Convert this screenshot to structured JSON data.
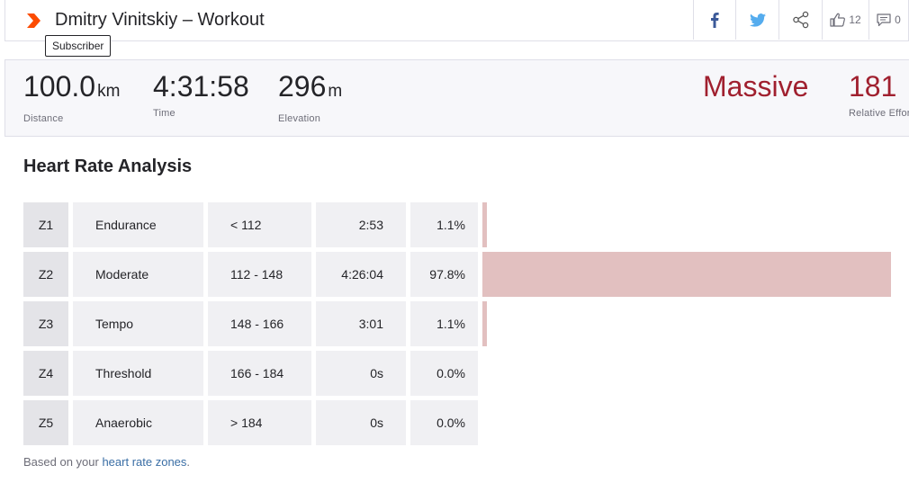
{
  "header": {
    "title": "Dmitry Vinitskiy – Workout",
    "tooltip": "Subscriber",
    "kudos_count": "12",
    "comment_count": "0"
  },
  "stats": [
    {
      "value": "100.0",
      "unit": "km",
      "label": "Distance"
    },
    {
      "value": "4:31:58",
      "unit": "",
      "label": "Time"
    },
    {
      "value": "296",
      "unit": "m",
      "label": "Elevation"
    }
  ],
  "relative_effort": {
    "level": "Massive",
    "value": "181",
    "label": "Relative Effort"
  },
  "heart_rate": {
    "title": "Heart Rate Analysis",
    "zones": [
      {
        "zone": "Z1",
        "name": "Endurance",
        "range": "< 112",
        "time": "2:53",
        "percent": "1.1%",
        "fraction": 0.011
      },
      {
        "zone": "Z2",
        "name": "Moderate",
        "range": "112 - 148",
        "time": "4:26:04",
        "percent": "97.8%",
        "fraction": 0.978
      },
      {
        "zone": "Z3",
        "name": "Tempo",
        "range": "148 - 166",
        "time": "3:01",
        "percent": "1.1%",
        "fraction": 0.011
      },
      {
        "zone": "Z4",
        "name": "Threshold",
        "range": "166 - 184",
        "time": "0s",
        "percent": "0.0%",
        "fraction": 0.0
      },
      {
        "zone": "Z5",
        "name": "Anaerobic",
        "range": "> 184",
        "time": "0s",
        "percent": "0.0%",
        "fraction": 0.0
      }
    ],
    "footnote_prefix": "Based on your ",
    "footnote_link": "heart rate zones",
    "footnote_suffix": "."
  },
  "colors": {
    "accent": "#fc4c02",
    "effort_red": "#a0202f",
    "bar_fill": "#e2c0c0",
    "facebook": "#3b5998",
    "twitter": "#55acee"
  },
  "icons": [
    "strava-logo-icon",
    "facebook-icon",
    "twitter-icon",
    "share-icon",
    "thumbs-up-icon",
    "comment-icon"
  ]
}
